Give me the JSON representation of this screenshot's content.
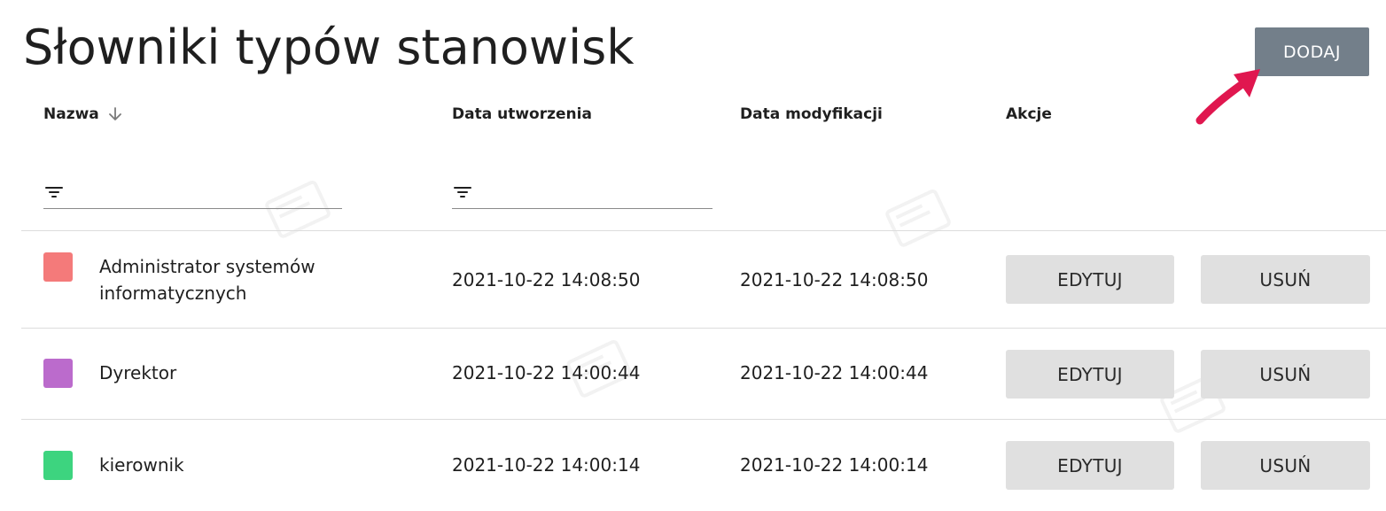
{
  "page": {
    "title": "Słowniki typów stanowisk"
  },
  "toolbar": {
    "add_label": "DODAJ"
  },
  "table": {
    "columns": {
      "name": "Nazwa",
      "created": "Data utworzenia",
      "modified": "Data modyfikacji",
      "actions": "Akcje"
    },
    "filters": {
      "name_placeholder": "",
      "created_placeholder": ""
    },
    "rows": [
      {
        "name": "Administrator systemów informatycznych",
        "color": "#f47a7a",
        "created": "2021-10-22 14:08:50",
        "modified": "2021-10-22 14:08:50",
        "edit_label": "EDYTUJ",
        "delete_label": "USUŃ"
      },
      {
        "name": "Dyrektor",
        "color": "#bb6bcc",
        "created": "2021-10-22 14:00:44",
        "modified": "2021-10-22 14:00:44",
        "edit_label": "EDYTUJ",
        "delete_label": "USUŃ"
      },
      {
        "name": "kierownik",
        "color": "#3dd47f",
        "created": "2021-10-22 14:00:14",
        "modified": "2021-10-22 14:00:14",
        "edit_label": "EDYTUJ",
        "delete_label": "USUŃ"
      }
    ]
  },
  "icons": {
    "sort": "arrow-down-icon",
    "filter": "filter-icon",
    "annotation": "arrow-pointer-icon"
  },
  "colors": {
    "add_button": "#737f8a",
    "action_button": "#e0e0e0",
    "annotation_arrow": "#e0174f"
  }
}
